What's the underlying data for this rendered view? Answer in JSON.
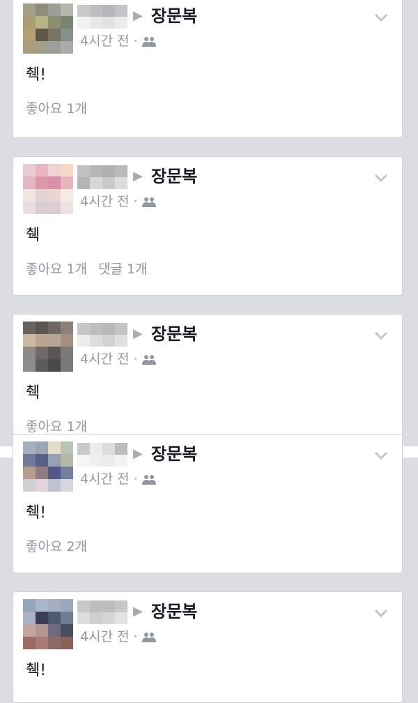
{
  "posts": [
    {
      "target": "장문복",
      "time": "4시간 전",
      "body": "췍!",
      "likes": "좋아요 1개",
      "comments": "",
      "avatar_colors": [
        "#a3a08a",
        "#8f8c7a",
        "#9aa096",
        "#b4b7aa",
        "#aa9d71",
        "#b7b487",
        "#8b8f6e",
        "#7b8371",
        "#b59f74",
        "#5d5844",
        "#777561",
        "#879089",
        "#aa9d7e",
        "#a39f86",
        "#9da09a",
        "#a9acab"
      ],
      "blur_colors": [
        "#c9c9cb",
        "#bfbfc3",
        "#b4b6bb",
        "#c3c3c7",
        "#f0f0f1",
        "#e8e8ea",
        "#e2e2e4",
        "#ececee"
      ]
    },
    {
      "target": "장문복",
      "time": "4시간 전",
      "body": "췍",
      "likes": "좋아요 1개",
      "comments": "댓글 1개",
      "avatar_colors": [
        "#eacbd1",
        "#e8b5c1",
        "#f1d2d6",
        "#f5d8c6",
        "#e2b7c2",
        "#db98ad",
        "#d991a9",
        "#e9b4c2",
        "#f3e4e0",
        "#e1d3d1",
        "#ebd5d3",
        "#f4ebe3",
        "#e8dede",
        "#d8cdd3",
        "#e0cbd5",
        "#ede2e2"
      ],
      "blur_colors": [
        "#c1c1c3",
        "#b7b7bb",
        "#b0b0b4",
        "#bababd",
        "#b4b4b8",
        "#d7d7d9",
        "#cacacc",
        "#dcdcde"
      ]
    },
    {
      "target": "장문복",
      "time": "4시간 전",
      "body": "췍",
      "likes": "좋아요 1개",
      "comments": "",
      "avatar_colors": [
        "#6a6260",
        "#5b5450",
        "#6f6763",
        "#8b817b",
        "#cdb9a4",
        "#bba58e",
        "#b7a493",
        "#a18f80",
        "#8f8a88",
        "#6e6867",
        "#5a5556",
        "#7b7877",
        "#8d8d8c",
        "#5d5c5c",
        "#4b4a4b",
        "#7a7979"
      ],
      "blur_colors": [
        "#c6c6c8",
        "#bebec2",
        "#b9b9bd",
        "#c4c4c7",
        "#ececed",
        "#dddde0",
        "#d2d2d5",
        "#e0e0e2"
      ]
    },
    {
      "target": "장문복",
      "time": "4시간 전",
      "body": "췍!",
      "likes": "좋아요 2개",
      "comments": "",
      "avatar_colors": [
        "#a7aec0",
        "#9ba5b3",
        "#e0dcc5",
        "#b7c3b3",
        "#6f7a98",
        "#596085",
        "#95a0b3",
        "#b4b8a8",
        "#b89c8c",
        "#8f7d82",
        "#505a86",
        "#747e9e",
        "#cfcfd6",
        "#e4d2dc",
        "#bfc2cf",
        "#d6d6de"
      ],
      "blur_colors": [
        "#c9c9cc",
        "#ececee",
        "#dddde0",
        "#bcbcc0",
        "#f4f4f5",
        "#efeff1",
        "#ececee",
        "#f2f2f3"
      ]
    },
    {
      "target": "장문복",
      "time": "4시간 전",
      "body": "췍!",
      "likes": "",
      "comments": "",
      "avatar_colors": [
        "#94a6be",
        "#a7b6ca",
        "#a7aec0",
        "#9ba7bd",
        "#a9b2c6",
        "#3b3d55",
        "#4d5a71",
        "#707c93",
        "#c4a49e",
        "#b49590",
        "#6f6a80",
        "#4a4d60",
        "#9a6a63",
        "#a87c75",
        "#8a6a66",
        "#8a6156"
      ],
      "blur_colors": [
        "#c9c9cc",
        "#bdbdc1",
        "#bcbcc0",
        "#c6c6c9",
        "#dcdcdf",
        "#cfcfd2",
        "#d5d5d8",
        "#e3e3e5"
      ]
    }
  ]
}
